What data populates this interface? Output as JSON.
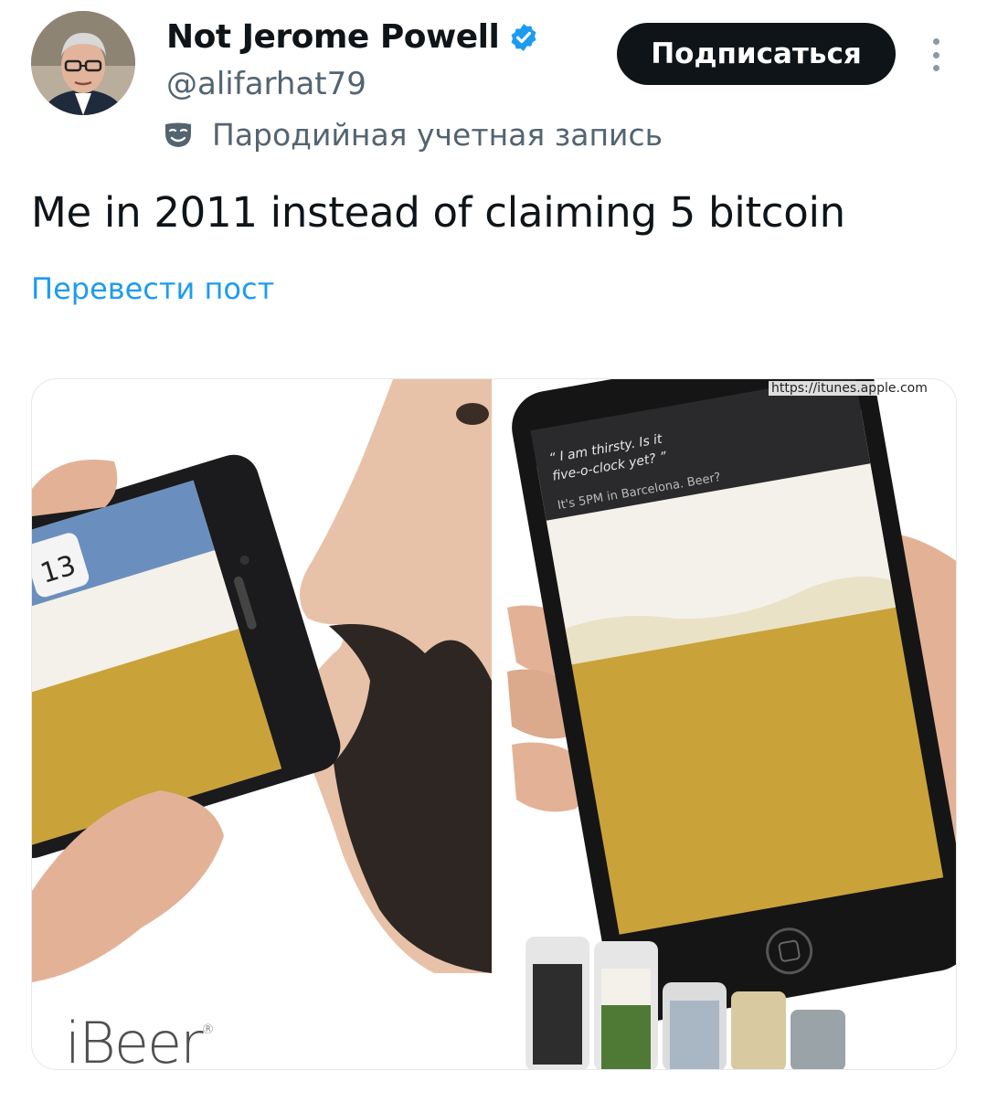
{
  "author": {
    "display_name": "Not Jerome Powell",
    "handle": "@alifarhat79",
    "parody_label": "Пародийная учетная запись"
  },
  "actions": {
    "follow_label": "Подписаться"
  },
  "tweet": {
    "text": "Me in 2011 instead of claiming 5 bitcoin",
    "translate_label": "Перевести пост"
  },
  "media": {
    "brand_text": "iBeer",
    "source_url": "https://itunes.apple.com",
    "siri_quote": "“ I am thirsty. Is it five-o-clock yet? ”",
    "siri_reply": "It's 5PM in Barcelona. Beer?",
    "calendar_day": "13"
  },
  "colors": {
    "accent": "#1d9bf0",
    "text_primary": "#0f1419",
    "text_secondary": "#536471",
    "follow_bg": "#0f1419",
    "beer": "#c9a23a",
    "foam": "#f3f1ea"
  }
}
